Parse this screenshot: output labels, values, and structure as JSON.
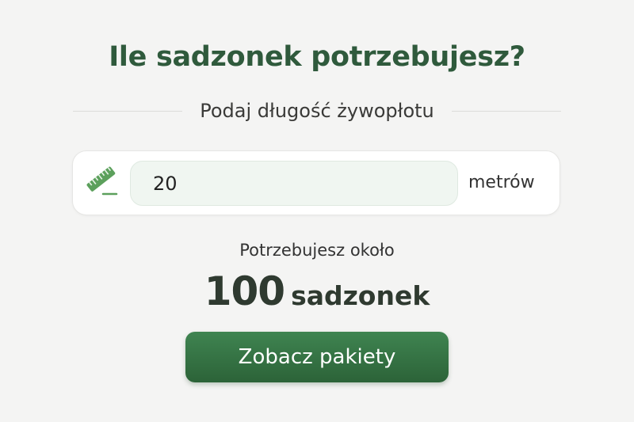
{
  "header": {
    "title": "Ile sadzonek potrzebujesz?",
    "subtitle": "Podaj długość żywopłotu"
  },
  "length_input": {
    "icon": "ruler-icon",
    "value": "20",
    "unit": "metrów"
  },
  "result": {
    "label": "Potrzebujesz około",
    "count": "100",
    "unit": "sadzonek"
  },
  "cta": {
    "label": "Zobacz pakiety"
  },
  "colors": {
    "title_green": "#2f5a3c",
    "button_green": "#357444",
    "icon_green": "#5ca05c",
    "input_background": "#f0f6f1",
    "page_background": "#f4f4f3"
  }
}
